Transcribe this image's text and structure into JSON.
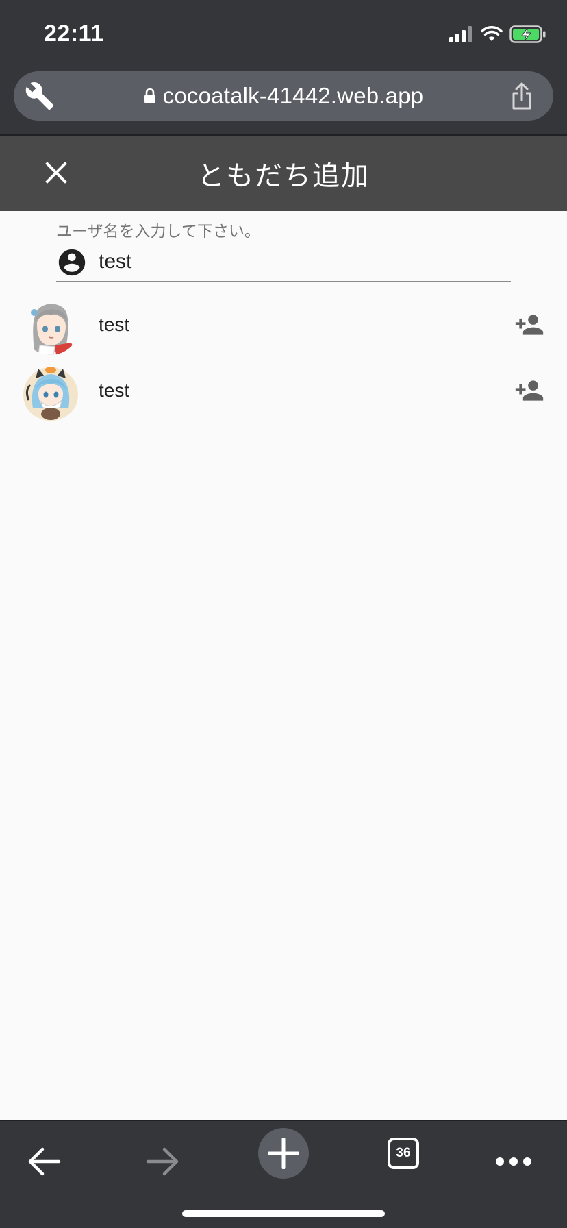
{
  "status_bar": {
    "time": "22:11",
    "icons": [
      "signal-icon",
      "wifi-icon",
      "battery-charging-icon"
    ],
    "battery_color": "#4cd964"
  },
  "browser": {
    "url": "cocoatalk-41442.web.app",
    "tab_count": "36",
    "toolbar_icons": [
      "back-arrow-icon",
      "forward-arrow-icon",
      "new-tab-plus-icon",
      "tab-switcher-icon",
      "more-dots-icon"
    ]
  },
  "header": {
    "title": "ともだち追加",
    "close_icon": "close-icon"
  },
  "search": {
    "label": "ユーザ名を入力して下さい。",
    "value": "test",
    "icon": "account-circle-icon"
  },
  "results": [
    {
      "name": "test",
      "avatar": "avatar-grey-hair-character",
      "action_icon": "person-add-icon"
    },
    {
      "name": "test",
      "avatar": "avatar-blue-hair-cat-character",
      "action_icon": "person-add-icon"
    }
  ],
  "colors": {
    "browser_chrome": "#35363a",
    "url_pill": "#5b5e64",
    "app_header": "#494949",
    "page_background": "#fafafa",
    "icon_grey": "#616161"
  }
}
